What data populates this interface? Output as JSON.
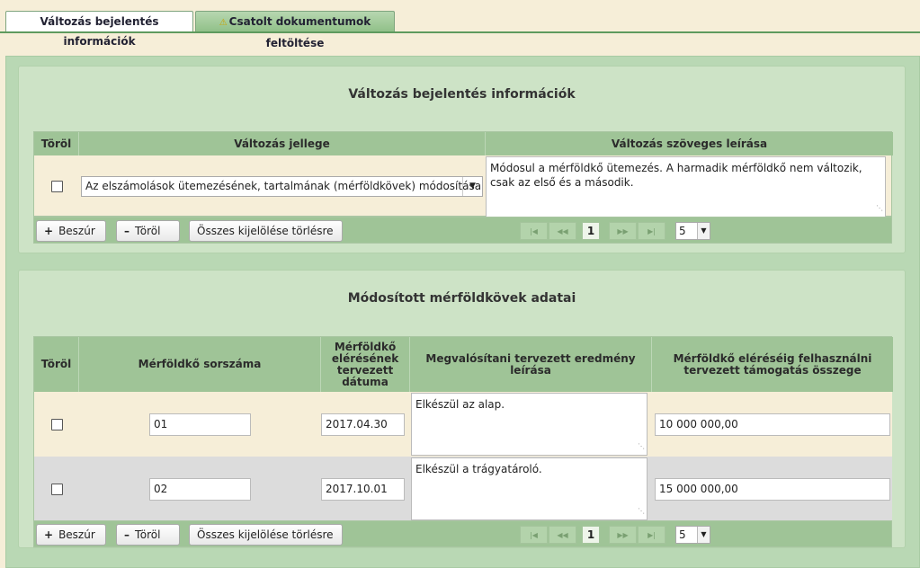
{
  "tabs": [
    {
      "label": "Változás bejelentés információk",
      "active": true
    },
    {
      "label": "Csatolt dokumentumok feltöltése",
      "active": false,
      "icon": "warning-icon"
    }
  ],
  "panel1": {
    "title": "Változás bejelentés információk",
    "columns": [
      "Töröl",
      "Változás jellege",
      "Változás szöveges leírása"
    ],
    "rows": [
      {
        "checked": false,
        "type": "Az elszámolások ütemezésének, tartalmának (mérföldkövek) módosítása",
        "description": "Módosul a mérföldkő ütemezés. A harmadik mérföldkő nem változik, csak az első és a második."
      }
    ],
    "toolbar": {
      "insert": "Beszúr",
      "delete": "Töröl",
      "clear_selection": "Összes kijelölése törlésre"
    },
    "pager": {
      "page": "1",
      "page_size": "5"
    }
  },
  "panel2": {
    "title": "Módosított mérföldkövek adatai",
    "columns": [
      "Töröl",
      "Mérföldkő sorszáma",
      "Mérföldkő elérésének tervezett dátuma",
      "Megvalósítani tervezett eredmény leírása",
      "Mérföldkő eléréséig felhasználni tervezett támogatás összege"
    ],
    "rows": [
      {
        "checked": false,
        "number": "01",
        "date": "2017.04.30",
        "result": "Elkészül az alap.",
        "amount": "10 000 000,00"
      },
      {
        "checked": false,
        "number": "02",
        "date": "2017.10.01",
        "result": "Elkészül a trágyatároló.",
        "amount": "15 000 000,00"
      }
    ],
    "toolbar": {
      "insert": "Beszúr",
      "delete": "Töröl",
      "clear_selection": "Összes kijelölése törlésre"
    },
    "pager": {
      "page": "1",
      "page_size": "5"
    }
  },
  "colors": {
    "page_bg": "#f6eed8",
    "panel_bg": "#cde3c6",
    "header_bg": "#9fc497",
    "row_alt": "#dcdcdc"
  }
}
